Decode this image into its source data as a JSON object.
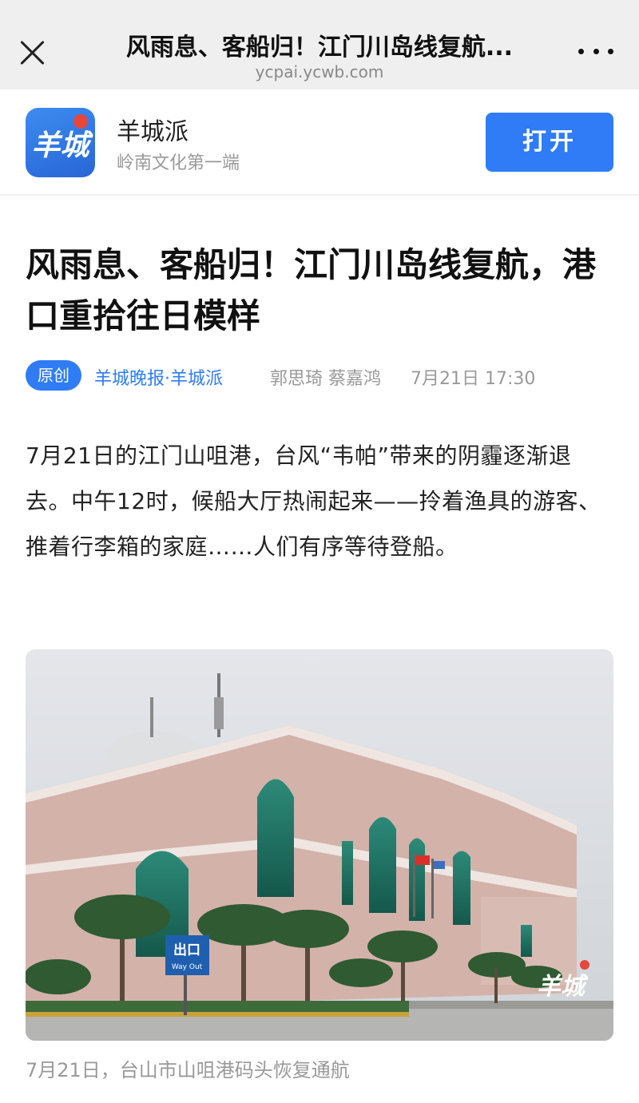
{
  "browser": {
    "title": "风雨息、客船归！江门川岛线复航...",
    "url": "ycpai.ycwb.com"
  },
  "app_banner": {
    "logo_text": "羊城",
    "name": "羊城派",
    "slogan": "岭南文化第一端",
    "open_label": "打开"
  },
  "article": {
    "headline": "风雨息、客船归！江门川岛线复航，港口重拾往日模样",
    "badge": "原创",
    "source": "羊城晚报·羊城派",
    "authors": "郭思琦 蔡嘉鸿",
    "time": "7月21日 17:30",
    "paragraph": "7月21日的江门山咀港，台风“韦帕”带来的阴霾逐渐退去。中午12时，候船大厅热闹起来——拎着渔具的游客、推着行李箱的家庭……人们有序等待登船。",
    "image_sign": "出口",
    "image_sign_en": "Way Out",
    "image_watermark": "羊城",
    "caption": "7月21日，台山市山咀港码头恢复通航"
  },
  "colors": {
    "accent": "#2f7cf6",
    "building": "#d3b2aa",
    "glass": "#1d6b5c"
  }
}
